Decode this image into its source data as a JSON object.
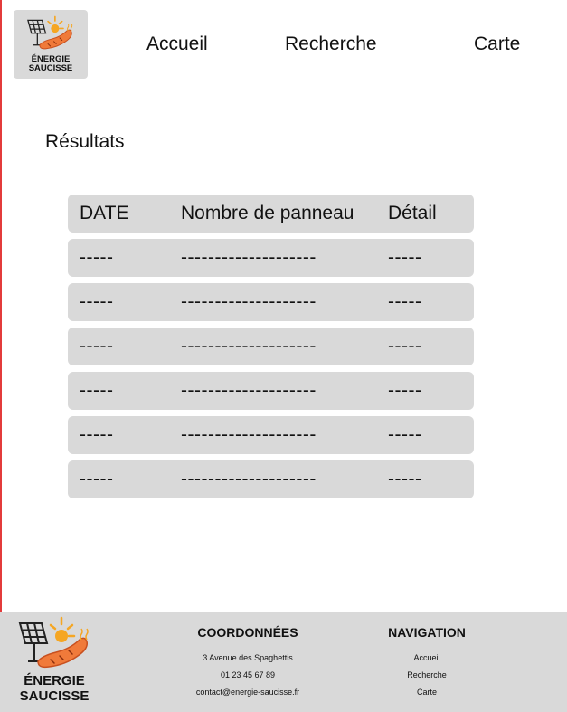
{
  "brand": {
    "line1": "ÉNERGIE",
    "line2": "SAUCISSE",
    "colors": {
      "sausage": "#f07a3a",
      "sun": "#f5a623",
      "panel": "#222222"
    }
  },
  "nav": {
    "items": [
      "Accueil",
      "Recherche",
      "Carte"
    ]
  },
  "page": {
    "title": "Résultats"
  },
  "table": {
    "headers": [
      "DATE",
      "Nombre de panneau",
      "Détail"
    ],
    "rows": [
      [
        "-----",
        "--------------------",
        "-----"
      ],
      [
        "-----",
        "--------------------",
        "-----"
      ],
      [
        "-----",
        "--------------------",
        "-----"
      ],
      [
        "-----",
        "--------------------",
        "-----"
      ],
      [
        "-----",
        "--------------------",
        "-----"
      ],
      [
        "-----",
        "--------------------",
        "-----"
      ]
    ]
  },
  "footer": {
    "coordinates": {
      "heading": "COORDONNÉES",
      "address": "3 Avenue des Spaghettis",
      "phone": "01 23 45 67 89",
      "email": "contact@energie-saucisse.fr"
    },
    "navigation": {
      "heading": "NAVIGATION",
      "items": [
        "Accueil",
        "Recherche",
        "Carte"
      ]
    }
  }
}
